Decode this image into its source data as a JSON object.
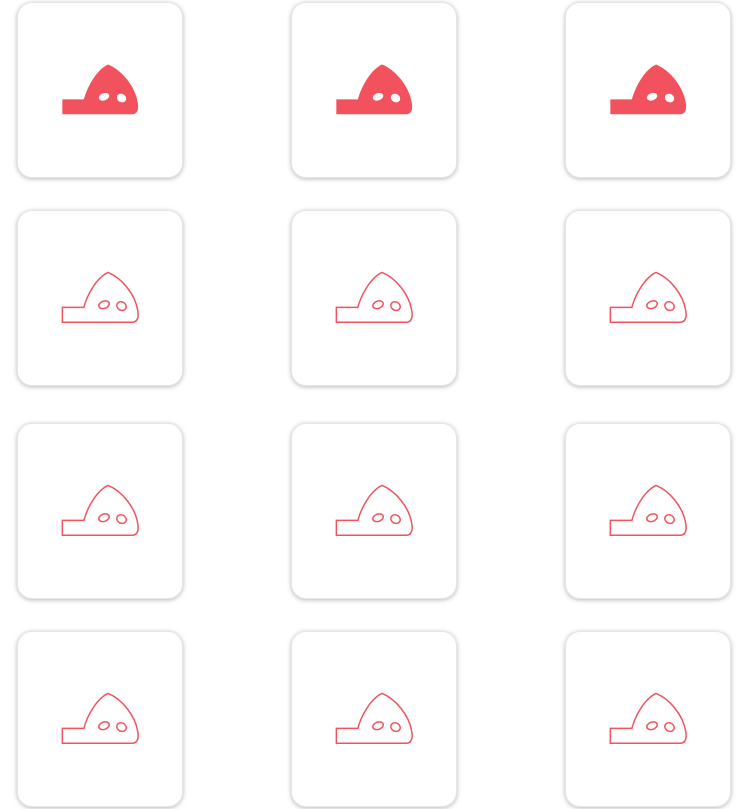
{
  "accent_color": "#f2525e",
  "tiles": [
    {
      "icon": "climbing-hold-icon",
      "selected": true
    },
    {
      "icon": "climbing-hold-icon",
      "selected": true
    },
    {
      "icon": "climbing-hold-icon",
      "selected": true
    },
    {
      "icon": "climbing-hold-icon",
      "selected": false
    },
    {
      "icon": "climbing-hold-icon",
      "selected": false
    },
    {
      "icon": "climbing-hold-icon",
      "selected": false
    },
    {
      "icon": "climbing-hold-icon",
      "selected": false
    },
    {
      "icon": "climbing-hold-icon",
      "selected": false
    },
    {
      "icon": "climbing-hold-icon",
      "selected": false
    },
    {
      "icon": "climbing-hold-icon",
      "selected": false
    },
    {
      "icon": "climbing-hold-icon",
      "selected": false
    },
    {
      "icon": "climbing-hold-icon",
      "selected": false
    }
  ]
}
